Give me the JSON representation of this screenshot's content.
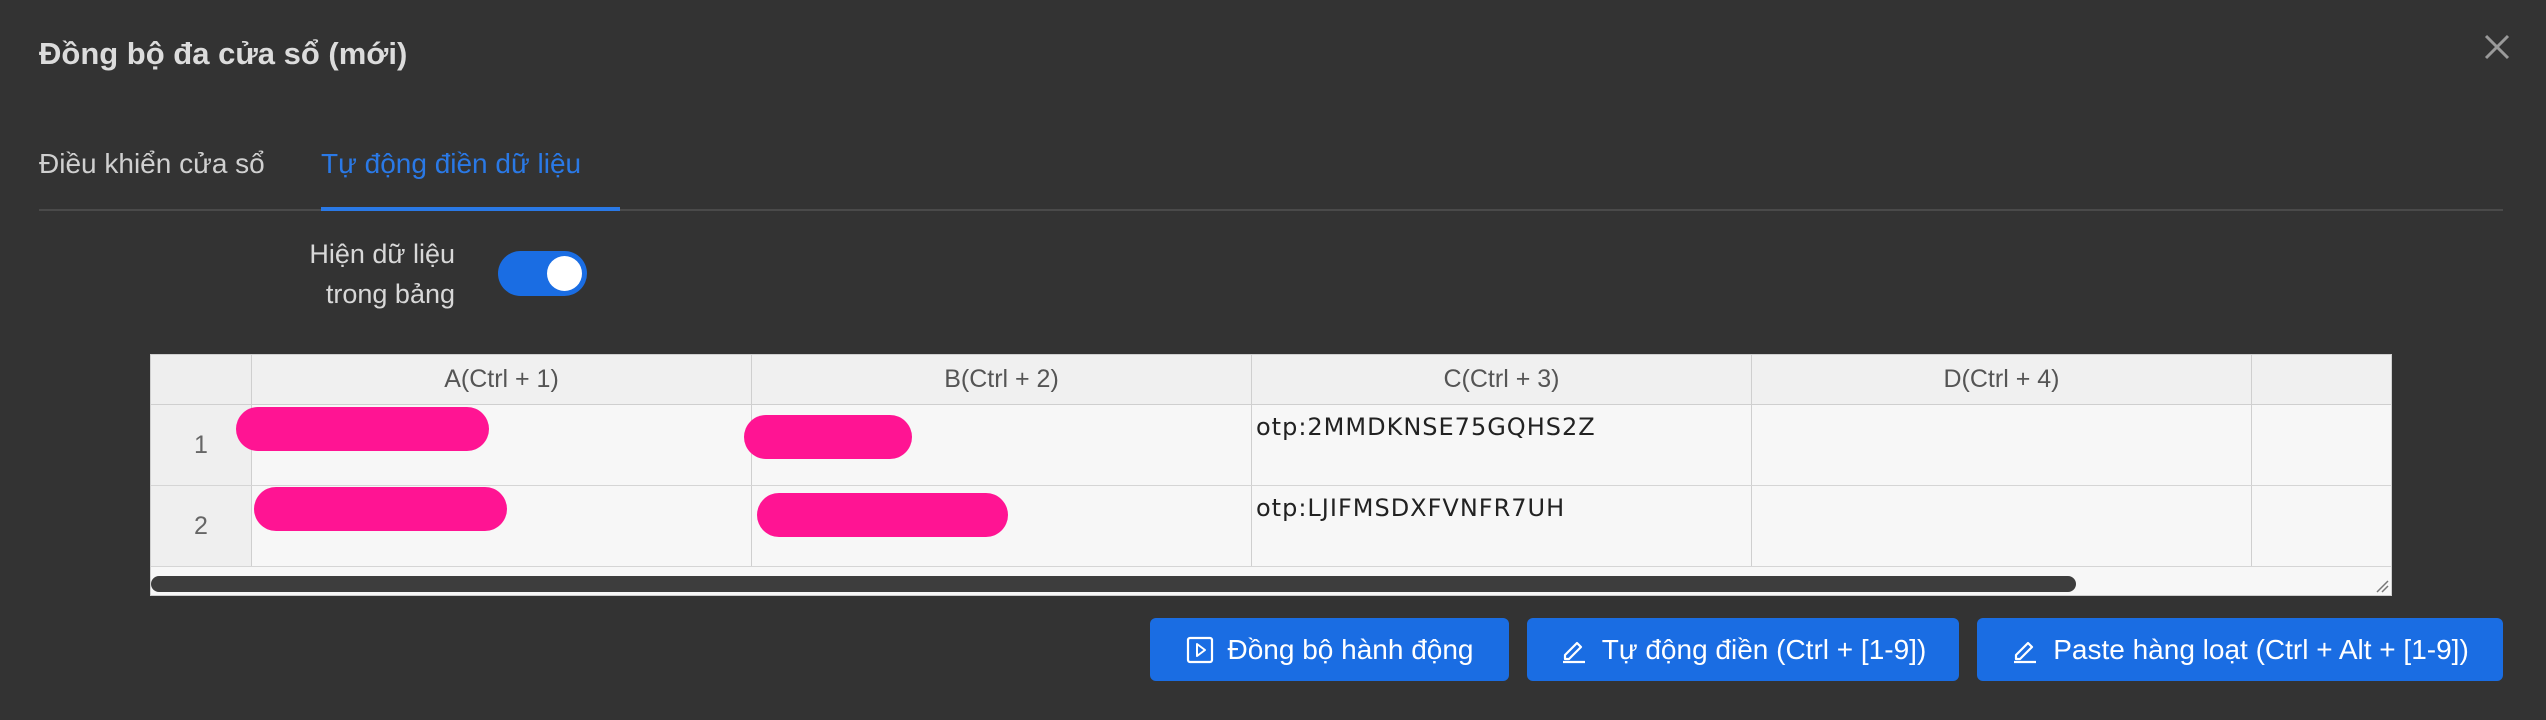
{
  "dialog": {
    "title": "Đồng bộ đa cửa sổ (mới)"
  },
  "tabs": [
    {
      "label": "Điều khiển cửa sổ",
      "active": false
    },
    {
      "label": "Tự động điền dữ liệu",
      "active": true
    }
  ],
  "toggle": {
    "label_line1": "Hiện dữ liệu",
    "label_line2": "trong bảng",
    "on": true
  },
  "sheet": {
    "columns": [
      "A(Ctrl + 1)",
      "B(Ctrl + 2)",
      "C(Ctrl + 3)",
      "D(Ctrl + 4)",
      ""
    ],
    "rows": [
      {
        "num": "1",
        "a": "",
        "b": "",
        "c": "otp:2MMDKNSE75GQHS2Z",
        "d": ""
      },
      {
        "num": "2",
        "a": "",
        "b": "",
        "c": "otp:LJIFMSDXFVNFR7UH",
        "d": ""
      }
    ]
  },
  "buttons": {
    "sync": "Đồng bộ hành động",
    "autofill": "Tự động điền (Ctrl + [1-9])",
    "paste": "Paste hàng loạt (Ctrl + Alt + [1-9])"
  },
  "colors": {
    "accent": "#1a6de3",
    "tab_active": "#2a79e6",
    "redaction": "#ff1493",
    "background": "#333333"
  },
  "icons": {
    "close": "close-icon",
    "sync": "play-square-icon",
    "edit": "pencil-icon"
  }
}
